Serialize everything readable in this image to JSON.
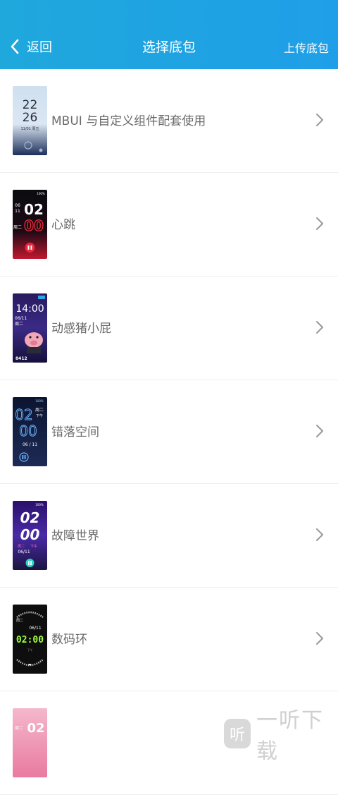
{
  "header": {
    "back_label": "返回",
    "title": "选择底包",
    "upload_label": "上传底包"
  },
  "items": [
    {
      "label": "MBUI 与自定义组件配套使用",
      "thumb": {
        "time_h": "22",
        "time_m": "26",
        "date": "11/01 周五"
      }
    },
    {
      "label": "心跳",
      "thumb": {
        "date_a": "06",
        "date_b": "11",
        "time_h": "02",
        "time_m": "00",
        "weekday": "周二",
        "battery": "100%"
      }
    },
    {
      "label": "动感猪小屁",
      "thumb": {
        "time": "14:00",
        "date": "06/11",
        "weekday": "周二",
        "steps": "8412"
      }
    },
    {
      "label": "错落空间",
      "thumb": {
        "time_h": "02",
        "time_m": "00",
        "weekday": "周二",
        "period": "下午",
        "date": "06 / 11",
        "battery": "100%"
      }
    },
    {
      "label": "故障世界",
      "thumb": {
        "time_h": "02",
        "time_m": "00",
        "weekday": "周二",
        "period": "下午",
        "date": "06/11",
        "battery": "100%"
      }
    },
    {
      "label": "数码环",
      "thumb": {
        "weekday": "周二",
        "date": "06/11",
        "time": "02:00",
        "period": "下午"
      }
    },
    {
      "label": "",
      "thumb": {
        "weekday": "周二",
        "time": "02"
      }
    }
  ],
  "watermark": {
    "logo_glyph": "听",
    "text": "一听下载"
  },
  "colors": {
    "header_start": "#1fa8dc",
    "header_end": "#1f9fe8",
    "label": "#6a6a6a",
    "divider": "#eeeeee",
    "chevron": "#999999"
  }
}
